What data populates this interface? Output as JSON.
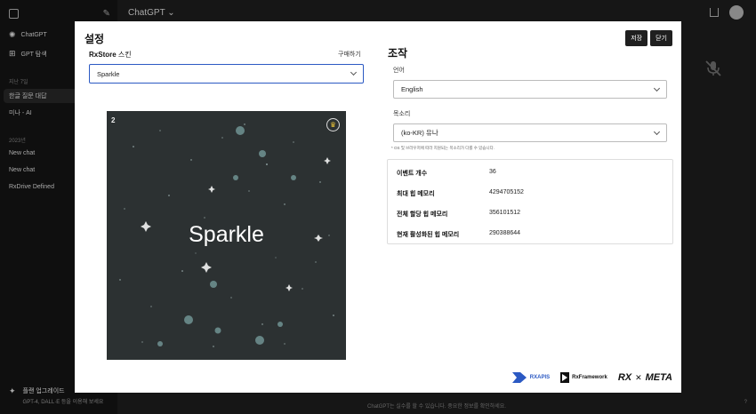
{
  "sidebar": {
    "app_label": "ChatGPT",
    "explore_label": "GPT 탐색",
    "section_7days": "지난 7일",
    "chats_recent": [
      "한글 질문 대답",
      "미나 - AI"
    ],
    "section_2023": "2023년",
    "chats_2023": [
      "New chat",
      "New chat",
      "RxDrive Defined"
    ],
    "upgrade_title": "플랜 업그레이드",
    "upgrade_sub": "GPT-4, DALL·E 등을 이용해 보세요"
  },
  "main": {
    "title": "ChatGPT ⌄",
    "footer": "ChatGPT는 실수를 할 수 있습니다. 중요한 정보를 확인하세요.",
    "help": "?"
  },
  "modal": {
    "title": "설정",
    "save_label": "저장",
    "close_label": "닫기",
    "skin_label_bold": "RxStore",
    "skin_label_rest": " 스킨",
    "buy_label": "구매하기",
    "skin_value": "Sparkle",
    "preview_number": "2",
    "preview_name": "Sparkle",
    "controls_title": "조작",
    "language_label": "언어",
    "language_value": "English",
    "voice_label": "목소리",
    "voice_value": "(ko-KR) 유나",
    "voice_hint": "* OS 및 브라우저에 따라 지원되는 목소리가 다를 수 있습니다.",
    "info_rows": [
      {
        "key": "이벤트 개수",
        "value": "36"
      },
      {
        "key": "최대 힙 메모리",
        "value": "4294705152"
      },
      {
        "key": "전체 할당 힙 메모리",
        "value": "356101512"
      },
      {
        "key": "현재 활성화된 힙 메모리",
        "value": "290388644"
      }
    ],
    "logo_global_label": "RXAPIS",
    "logo_framework_label": "RxFramework",
    "logo_rx_label": "RX",
    "logo_meta_label": "META"
  },
  "colors": {
    "accent_focus": "#2b59c3",
    "crown": "#e6c13a",
    "preview_bg": "#2c3132"
  }
}
